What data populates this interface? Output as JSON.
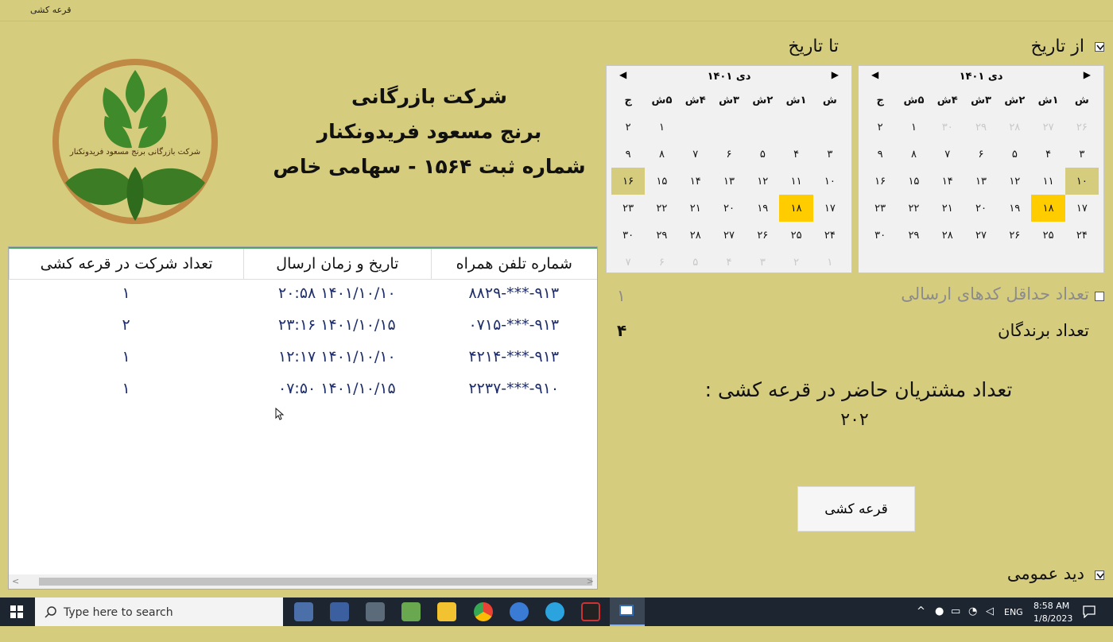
{
  "window": {
    "title": "قرعه کشی"
  },
  "company": {
    "line1": "شرکت بازرگانی",
    "line2": "برنج مسعود فریدونکنار",
    "line3": "شماره ثبت ۱۵۶۴ - سهامی خاص",
    "logo_text": "شرکت بازرگانی برنج مسعود فریدونکنار"
  },
  "from_date": {
    "label": "از تاریخ",
    "checked": true
  },
  "to_date": {
    "label": "تا تاریخ"
  },
  "calendar_from": {
    "title": "دی ۱۴۰۱",
    "weekdays": [
      "ش",
      "۱ش",
      "۲ش",
      "۳ش",
      "۴ش",
      "۵ش",
      "ج"
    ],
    "cells": [
      {
        "d": "۲۶",
        "s": "dim"
      },
      {
        "d": "۲۷",
        "s": "dim"
      },
      {
        "d": "۲۸",
        "s": "dim"
      },
      {
        "d": "۲۹",
        "s": "dim"
      },
      {
        "d": "۳۰",
        "s": "dim"
      },
      {
        "d": "۱",
        "s": ""
      },
      {
        "d": "۲",
        "s": ""
      },
      {
        "d": "۳",
        "s": ""
      },
      {
        "d": "۴",
        "s": ""
      },
      {
        "d": "۵",
        "s": ""
      },
      {
        "d": "۶",
        "s": ""
      },
      {
        "d": "۷",
        "s": ""
      },
      {
        "d": "۸",
        "s": ""
      },
      {
        "d": "۹",
        "s": ""
      },
      {
        "d": "۱۰",
        "s": "rng"
      },
      {
        "d": "۱۱",
        "s": ""
      },
      {
        "d": "۱۲",
        "s": ""
      },
      {
        "d": "۱۳",
        "s": ""
      },
      {
        "d": "۱۴",
        "s": ""
      },
      {
        "d": "۱۵",
        "s": ""
      },
      {
        "d": "۱۶",
        "s": ""
      },
      {
        "d": "۱۷",
        "s": ""
      },
      {
        "d": "۱۸",
        "s": "sel"
      },
      {
        "d": "۱۹",
        "s": ""
      },
      {
        "d": "۲۰",
        "s": ""
      },
      {
        "d": "۲۱",
        "s": ""
      },
      {
        "d": "۲۲",
        "s": ""
      },
      {
        "d": "۲۳",
        "s": ""
      },
      {
        "d": "۲۴",
        "s": ""
      },
      {
        "d": "۲۵",
        "s": ""
      },
      {
        "d": "۲۶",
        "s": ""
      },
      {
        "d": "۲۷",
        "s": ""
      },
      {
        "d": "۲۸",
        "s": ""
      },
      {
        "d": "۲۹",
        "s": ""
      },
      {
        "d": "۳۰",
        "s": ""
      }
    ]
  },
  "calendar_to": {
    "title": "دی ۱۴۰۱",
    "weekdays": [
      "ش",
      "۱ش",
      "۲ش",
      "۳ش",
      "۴ش",
      "۵ش",
      "ج"
    ],
    "cells": [
      {
        "d": "",
        "s": ""
      },
      {
        "d": "",
        "s": ""
      },
      {
        "d": "",
        "s": ""
      },
      {
        "d": "",
        "s": ""
      },
      {
        "d": "",
        "s": ""
      },
      {
        "d": "۱",
        "s": ""
      },
      {
        "d": "۲",
        "s": ""
      },
      {
        "d": "۳",
        "s": ""
      },
      {
        "d": "۴",
        "s": ""
      },
      {
        "d": "۵",
        "s": ""
      },
      {
        "d": "۶",
        "s": ""
      },
      {
        "d": "۷",
        "s": ""
      },
      {
        "d": "۸",
        "s": ""
      },
      {
        "d": "۹",
        "s": ""
      },
      {
        "d": "۱۰",
        "s": ""
      },
      {
        "d": "۱۱",
        "s": ""
      },
      {
        "d": "۱۲",
        "s": ""
      },
      {
        "d": "۱۳",
        "s": ""
      },
      {
        "d": "۱۴",
        "s": ""
      },
      {
        "d": "۱۵",
        "s": ""
      },
      {
        "d": "۱۶",
        "s": "rng"
      },
      {
        "d": "۱۷",
        "s": ""
      },
      {
        "d": "۱۸",
        "s": "sel"
      },
      {
        "d": "۱۹",
        "s": ""
      },
      {
        "d": "۲۰",
        "s": ""
      },
      {
        "d": "۲۱",
        "s": ""
      },
      {
        "d": "۲۲",
        "s": ""
      },
      {
        "d": "۲۳",
        "s": ""
      },
      {
        "d": "۲۴",
        "s": ""
      },
      {
        "d": "۲۵",
        "s": ""
      },
      {
        "d": "۲۶",
        "s": ""
      },
      {
        "d": "۲۷",
        "s": ""
      },
      {
        "d": "۲۸",
        "s": ""
      },
      {
        "d": "۲۹",
        "s": ""
      },
      {
        "d": "۳۰",
        "s": ""
      },
      {
        "d": "۱",
        "s": "dim"
      },
      {
        "d": "۲",
        "s": "dim"
      },
      {
        "d": "۳",
        "s": "dim"
      },
      {
        "d": "۴",
        "s": "dim"
      },
      {
        "d": "۵",
        "s": "dim"
      },
      {
        "d": "۶",
        "s": "dim"
      },
      {
        "d": "۷",
        "s": "dim"
      }
    ]
  },
  "min_codes": {
    "label": "تعداد حداقل کدهای ارسالی",
    "value": "۱",
    "checked": false
  },
  "winners": {
    "label": "تعداد برندگان",
    "value": "۴"
  },
  "attendees": {
    "label": "تعداد مشتریان حاضر در قرعه کشی :",
    "value": "۲۰۲"
  },
  "draw_button": {
    "label": "قرعه کشی"
  },
  "overview": {
    "label": "دید عمومی",
    "checked": true
  },
  "table": {
    "headers": [
      "شماره تلفن همراه",
      "تاریخ و زمان ارسال",
      "تعداد شرکت در قرعه کشی"
    ],
    "rows": [
      [
        "۹۱۳-***-۸۸۲۹",
        "۱۴۰۱/۱۰/۱۰ ۲۰:۵۸",
        "۱"
      ],
      [
        "۹۱۳-***-۰۷۱۵",
        "۱۴۰۱/۱۰/۱۵ ۲۳:۱۶",
        "۲"
      ],
      [
        "۹۱۳-***-۴۲۱۴",
        "۱۴۰۱/۱۰/۱۰ ۱۲:۱۷",
        "۱"
      ],
      [
        "۹۱۰-***-۲۲۳۷",
        "۱۴۰۱/۱۰/۱۵ ۰۷:۵۰",
        "۱"
      ]
    ]
  },
  "taskbar": {
    "search_placeholder": "Type here to search",
    "lang": "ENG",
    "time": "8:58 AM",
    "date": "1/8/2023"
  },
  "colors": {
    "background": "#d6cc7e",
    "selected_day": "#ffcc00",
    "table_text": "#1d2d6b"
  }
}
